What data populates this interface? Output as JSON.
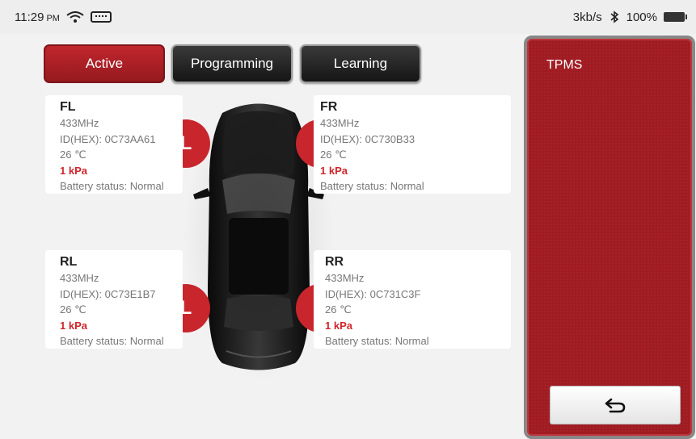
{
  "status": {
    "time": "11:29",
    "ampm": "PM",
    "speed": "3kb/s",
    "bluetooth": "bluetooth-icon",
    "battery": "100%"
  },
  "tabs": [
    {
      "label": "Active",
      "state": "selected"
    },
    {
      "label": "Programming"
    },
    {
      "label": "Learning"
    }
  ],
  "colors": {
    "accent": "#c0262d",
    "pressure": "#d0262c",
    "panel": "#a01c22"
  },
  "tires": {
    "fl": {
      "position": "FL",
      "frequency": "433MHz",
      "id": "ID(HEX): 0C73AA61",
      "temp": "26 ℃",
      "pressure": "1 kPa",
      "battery": "Battery status: Normal",
      "marker": "L"
    },
    "fr": {
      "position": "FR",
      "frequency": "433MHz",
      "id": "ID(HEX): 0C730B33",
      "temp": "26 ℃",
      "pressure": "1 kPa",
      "battery": "Battery status: Normal",
      "marker": "R"
    },
    "rl": {
      "position": "RL",
      "frequency": "433MHz",
      "id": "ID(HEX): 0C73E1B7",
      "temp": "26 ℃",
      "pressure": "1 kPa",
      "battery": "Battery status: Normal",
      "marker": "L"
    },
    "rr": {
      "position": "RR",
      "frequency": "433MHz",
      "id": "ID(HEX): 0C731C3F",
      "temp": "26 ℃",
      "pressure": "1 kPa",
      "battery": "Battery status: Normal",
      "marker": "R"
    }
  },
  "panel": {
    "title": "TPMS",
    "back_icon": "back-arrow-icon"
  }
}
